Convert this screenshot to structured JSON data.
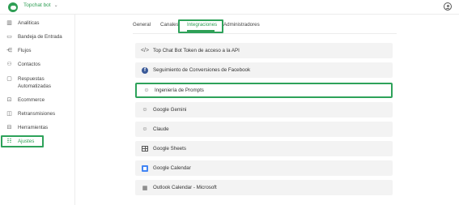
{
  "topbar": {
    "bot_name": "Topchat bot",
    "chevron_icon": "chevron-down-icon",
    "user_icon": "user-circle-icon"
  },
  "sidebar": {
    "items": [
      {
        "label": "Analiticas",
        "icon": "analytics-icon"
      },
      {
        "label": "Bandeja de Entrada",
        "icon": "inbox-icon"
      },
      {
        "label": "Flujos",
        "icon": "flows-icon"
      },
      {
        "label": "Contactos",
        "icon": "contacts-icon"
      },
      {
        "label": "Respuestas Automatizadas",
        "icon": "automated-replies-icon"
      },
      {
        "label": "Ecommerce",
        "icon": "ecommerce-icon"
      },
      {
        "label": "Retransmisiones",
        "icon": "broadcast-icon"
      },
      {
        "label": "Herramientas",
        "icon": "tools-icon"
      },
      {
        "label": "Ajustes",
        "icon": "settings-icon",
        "active": true
      }
    ]
  },
  "tabs": [
    {
      "label": "General"
    },
    {
      "label": "Canales"
    },
    {
      "label": "Integraciones",
      "active": true
    },
    {
      "label": "Administradores"
    }
  ],
  "integrations": [
    {
      "label": "Top Chat Bot Token de acceso a la API",
      "icon": "code-icon"
    },
    {
      "label": "Seguimiento de Conversiones de Facebook",
      "icon": "facebook-icon"
    },
    {
      "label": "Ingeniería de Prompts",
      "icon": "prompt-head-icon",
      "highlighted": true
    },
    {
      "label": "Google Gemini",
      "icon": "gemini-icon"
    },
    {
      "label": "Claude",
      "icon": "claude-icon"
    },
    {
      "label": "Google Sheets",
      "icon": "sheets-icon"
    },
    {
      "label": "Google Calendar",
      "icon": "google-calendar-icon"
    },
    {
      "label": "Outlook Calendar - Microsoft",
      "icon": "outlook-calendar-icon"
    }
  ],
  "colors": {
    "accent": "#2e9e54",
    "highlight_border": "#2ea25a",
    "row_bg": "#f3f3f3"
  }
}
